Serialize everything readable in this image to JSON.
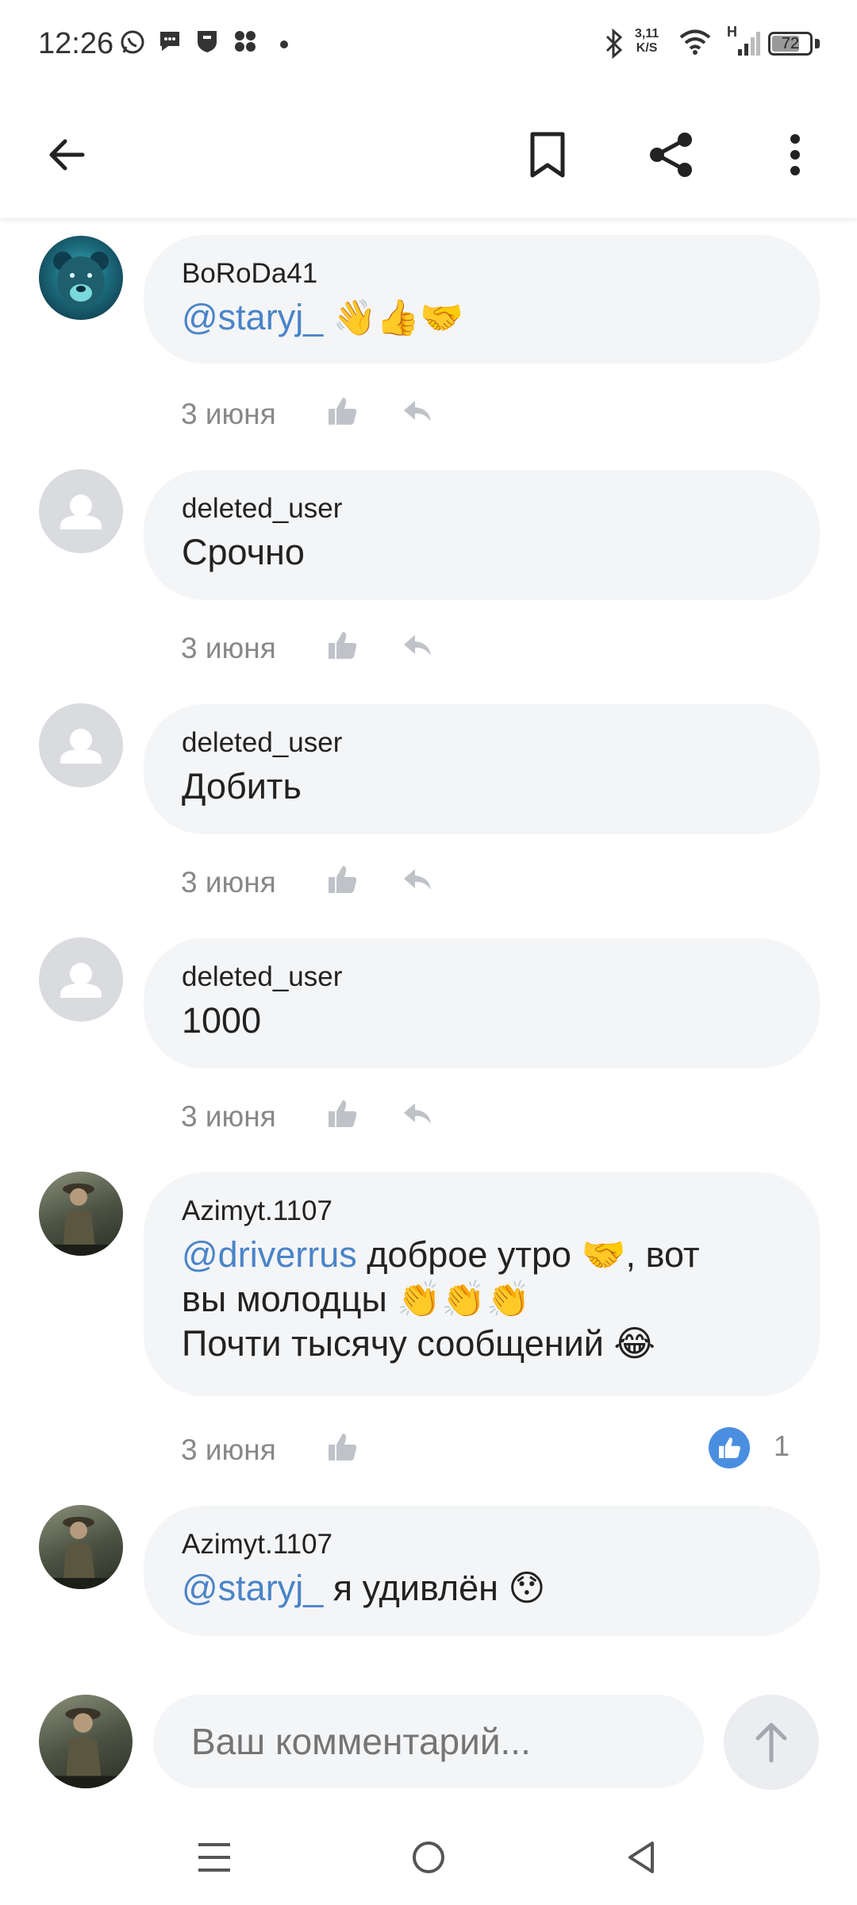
{
  "status_bar": {
    "time": "12:26",
    "net_speed_value": "3,11",
    "net_speed_unit": "K/S",
    "network_type": "H",
    "battery_level": "72",
    "icons": [
      "whatsapp-icon",
      "chat-icon",
      "shield-icon",
      "apps-icon",
      "dot-icon",
      "bluetooth-icon",
      "wifi-icon",
      "signal-icon",
      "battery-icon"
    ]
  },
  "header": {
    "icons": [
      "back-arrow-icon",
      "bookmark-icon",
      "share-icon",
      "more-vert-icon"
    ]
  },
  "comments": [
    {
      "author": "BoRoDa41",
      "mention": "@staryj_",
      "text": " 👋👍🤝",
      "date": "3 июня",
      "avatar": "bear-avatar"
    },
    {
      "author": "deleted_user",
      "text": "Срочно",
      "date": "3 июня",
      "avatar": "placeholder-avatar"
    },
    {
      "author": "deleted_user",
      "text": "Добить",
      "date": "3 июня",
      "avatar": "placeholder-avatar"
    },
    {
      "author": "deleted_user",
      "text": "1000",
      "date": "3 июня",
      "avatar": "placeholder-avatar"
    },
    {
      "author": "Azimyt.1107",
      "mention": "@driverrus",
      "text_line1": " доброе утро 🤝, вот",
      "text_line2": "вы молодцы 👏👏👏",
      "text_line3": "Почти тысячу сообщений 😂",
      "date": "3 июня",
      "likes": "1",
      "avatar": "photo-avatar"
    },
    {
      "author": "Azimyt.1107",
      "mention": "@staryj_",
      "text": " я удивлён 😯",
      "avatar": "photo-avatar"
    }
  ],
  "composer": {
    "placeholder": "Ваш комментарий..."
  },
  "nav_bar": {
    "icons": [
      "menu-icon",
      "home-icon",
      "back-triangle-icon"
    ]
  },
  "colors": {
    "mention": "#4a84c8",
    "bubble": "#f4f5f7",
    "meta_text": "#888888",
    "like_badge": "#4a8ee0"
  }
}
